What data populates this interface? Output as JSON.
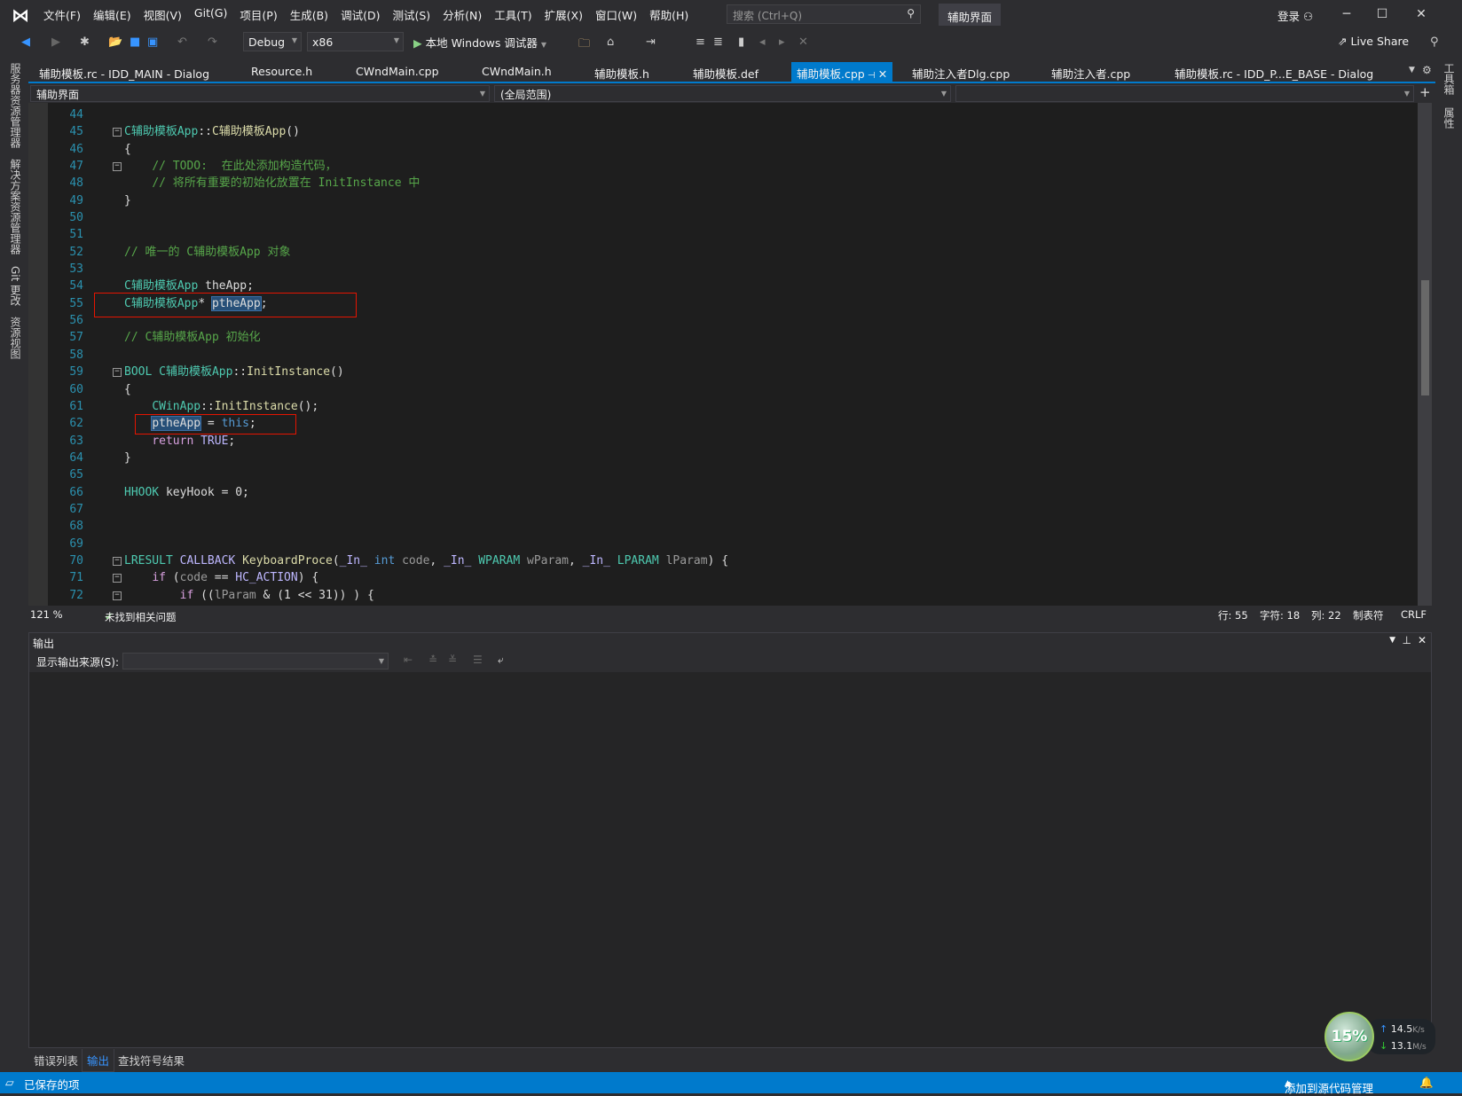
{
  "menubar": {
    "items": [
      "文件(F)",
      "编辑(E)",
      "视图(V)",
      "Git(G)",
      "项目(P)",
      "生成(B)",
      "调试(D)",
      "测试(S)",
      "分析(N)",
      "工具(T)",
      "扩展(X)",
      "窗口(W)",
      "帮助(H)"
    ],
    "search_placeholder": "搜索 (Ctrl+Q)",
    "solution_title": "辅助界面",
    "login": "登录"
  },
  "toolbar": {
    "config": "Debug",
    "platform": "x86",
    "run_label": "本地 Windows 调试器",
    "live_share": "Live Share"
  },
  "tabs": [
    {
      "label": "辅助模板.rc - IDD_MAIN - Dialog"
    },
    {
      "label": "Resource.h"
    },
    {
      "label": "CWndMain.cpp"
    },
    {
      "label": "CWndMain.h"
    },
    {
      "label": "辅助模板.h"
    },
    {
      "label": "辅助模板.def"
    },
    {
      "label": "辅助模板.cpp",
      "active": true
    },
    {
      "label": "辅助注入者Dlg.cpp"
    },
    {
      "label": "辅助注入者.cpp"
    },
    {
      "label": "辅助模板.rc - IDD_P...E_BASE - Dialog"
    }
  ],
  "navbar": {
    "project": "辅助界面",
    "scope": "(全局范围)",
    "member": ""
  },
  "left_strip": [
    "服务器资源管理器",
    "解决方案资源管理器",
    "Git 更改",
    "资源视图"
  ],
  "right_strip": [
    "工具箱",
    "属性"
  ],
  "code": [
    {
      "n": "44",
      "tokens": []
    },
    {
      "n": "45",
      "fold": true,
      "tokens": [
        [
          "C辅助模板App",
          "t"
        ],
        [
          "::",
          "p"
        ],
        [
          "C辅助模板App",
          "f"
        ],
        [
          "()",
          "p"
        ]
      ]
    },
    {
      "n": "46",
      "tokens": [
        [
          "{",
          "p"
        ]
      ]
    },
    {
      "n": "47",
      "fold": true,
      "tokens": [
        [
          "    ",
          "p"
        ],
        [
          "// TODO:  在此处添加构造代码，",
          "c"
        ]
      ]
    },
    {
      "n": "48",
      "tokens": [
        [
          "    ",
          "p"
        ],
        [
          "// 将所有重要的初始化放置在 InitInstance 中",
          "c"
        ]
      ]
    },
    {
      "n": "49",
      "tokens": [
        [
          "}",
          "p"
        ]
      ]
    },
    {
      "n": "50",
      "tokens": []
    },
    {
      "n": "51",
      "tokens": []
    },
    {
      "n": "52",
      "tokens": [
        [
          "// 唯一的 C辅助模板App 对象",
          "c"
        ]
      ]
    },
    {
      "n": "53",
      "tokens": []
    },
    {
      "n": "54",
      "tokens": [
        [
          "C辅助模板App",
          "t"
        ],
        [
          " theApp;",
          "p"
        ]
      ]
    },
    {
      "n": "55",
      "tokens": [
        [
          "C辅助模板App",
          "t"
        ],
        [
          "* ",
          "p"
        ],
        [
          "ptheApp",
          "p sel"
        ],
        [
          ";",
          "p"
        ]
      ]
    },
    {
      "n": "56",
      "tokens": []
    },
    {
      "n": "57",
      "tokens": [
        [
          "// C辅助模板App 初始化",
          "c"
        ]
      ]
    },
    {
      "n": "58",
      "tokens": []
    },
    {
      "n": "59",
      "fold": true,
      "tokens": [
        [
          "BOOL",
          "t"
        ],
        [
          " ",
          "p"
        ],
        [
          "C辅助模板App",
          "t"
        ],
        [
          "::",
          "p"
        ],
        [
          "InitInstance",
          "f"
        ],
        [
          "()",
          "p"
        ]
      ]
    },
    {
      "n": "60",
      "tokens": [
        [
          "{",
          "p"
        ]
      ]
    },
    {
      "n": "61",
      "tokens": [
        [
          "    ",
          "p"
        ],
        [
          "CWinApp",
          "t"
        ],
        [
          "::",
          "p"
        ],
        [
          "InitInstance",
          "f"
        ],
        [
          "();",
          "p"
        ]
      ]
    },
    {
      "n": "62",
      "tokens": [
        [
          "    ",
          "p"
        ],
        [
          "ptheApp",
          "p sel"
        ],
        [
          " = ",
          "p"
        ],
        [
          "this",
          "k"
        ],
        [
          ";",
          "p"
        ]
      ]
    },
    {
      "n": "63",
      "tokens": [
        [
          "    ",
          "p"
        ],
        [
          "return",
          "r"
        ],
        [
          " ",
          "p"
        ],
        [
          "TRUE",
          "m"
        ],
        [
          ";",
          "p"
        ]
      ]
    },
    {
      "n": "64",
      "tokens": [
        [
          "}",
          "p"
        ]
      ]
    },
    {
      "n": "65",
      "tokens": []
    },
    {
      "n": "66",
      "tokens": [
        [
          "HHOOK",
          "t"
        ],
        [
          " keyHook = 0;",
          "p"
        ]
      ]
    },
    {
      "n": "67",
      "tokens": []
    },
    {
      "n": "68",
      "tokens": []
    },
    {
      "n": "69",
      "tokens": []
    },
    {
      "n": "70",
      "fold": true,
      "tokens": [
        [
          "LRESULT",
          "t"
        ],
        [
          " ",
          "p"
        ],
        [
          "CALLBACK",
          "m"
        ],
        [
          " ",
          "p"
        ],
        [
          "KeyboardProce",
          "f"
        ],
        [
          "(",
          "p"
        ],
        [
          "_In_",
          "m"
        ],
        [
          " ",
          "p"
        ],
        [
          "int",
          "k"
        ],
        [
          " ",
          "p"
        ],
        [
          "code",
          "g"
        ],
        [
          ", ",
          "p"
        ],
        [
          "_In_",
          "m"
        ],
        [
          " ",
          "p"
        ],
        [
          "WPARAM",
          "t"
        ],
        [
          " ",
          "p"
        ],
        [
          "wParam",
          "g"
        ],
        [
          ", ",
          "p"
        ],
        [
          "_In_",
          "m"
        ],
        [
          " ",
          "p"
        ],
        [
          "LPARAM",
          "t"
        ],
        [
          " ",
          "p"
        ],
        [
          "lParam",
          "g"
        ],
        [
          ") {",
          "p"
        ]
      ]
    },
    {
      "n": "71",
      "fold": true,
      "tokens": [
        [
          "    ",
          "p"
        ],
        [
          "if",
          "r"
        ],
        [
          " (",
          "p"
        ],
        [
          "code",
          "g"
        ],
        [
          " == ",
          "p"
        ],
        [
          "HC_ACTION",
          "m"
        ],
        [
          ") {",
          "p"
        ]
      ]
    },
    {
      "n": "72",
      "fold": true,
      "tokens": [
        [
          "        ",
          "p"
        ],
        [
          "if",
          "r"
        ],
        [
          " ((",
          "p"
        ],
        [
          "lParam",
          "g"
        ],
        [
          " & (1 << 31)) ) {",
          "p"
        ]
      ]
    }
  ],
  "editor_status": {
    "zoom": "121 %",
    "issues": "未找到相关问题",
    "line": "行: 55",
    "char": "字符: 18",
    "col": "列: 22",
    "indent": "制表符",
    "eol": "CRLF"
  },
  "output": {
    "title": "输出",
    "source_label": "显示输出来源(S):",
    "source_value": ""
  },
  "bottom_tabs": [
    {
      "label": "错误列表"
    },
    {
      "label": "输出",
      "active": true
    },
    {
      "label": "查找符号结果"
    }
  ],
  "statusbar": {
    "left": "已保存的项",
    "source_control": "添加到源代码管理"
  },
  "widget": {
    "percent": "15%",
    "upload": "14.5",
    "upload_unit": "K/s",
    "download": "13.1",
    "download_unit": "M/s"
  },
  "colors": {
    "accent": "#007acc",
    "selection": "#264f78",
    "highlight_box": "#e51400"
  }
}
